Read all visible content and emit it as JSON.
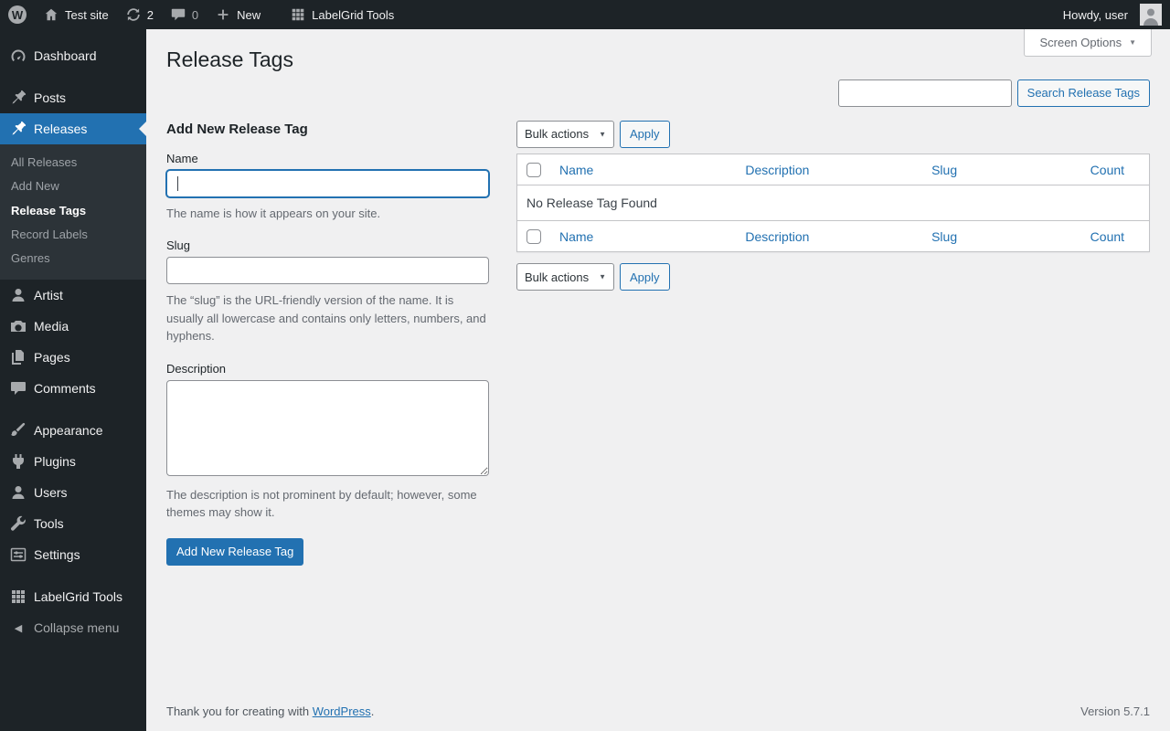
{
  "colors": {
    "accent": "#2271b1",
    "bar_bg": "#1d2327",
    "submenu_bg": "#2c3338",
    "content_bg": "#f0f0f1"
  },
  "icons": {
    "wp_logo": "W",
    "chevron_down": "▼",
    "collapse_arrow": "◀"
  },
  "admin_bar": {
    "site_name": "Test site",
    "updates_count": "2",
    "comments_count": "0",
    "new_label": "New",
    "labelgrid_label": "LabelGrid Tools",
    "howdy_label": "Howdy, user"
  },
  "sidebar": {
    "dashboard": "Dashboard",
    "posts": "Posts",
    "releases": "Releases",
    "submenu": {
      "all_releases": "All Releases",
      "add_new": "Add New",
      "release_tags": "Release Tags",
      "record_labels": "Record Labels",
      "genres": "Genres"
    },
    "artist": "Artist",
    "media": "Media",
    "pages": "Pages",
    "comments": "Comments",
    "appearance": "Appearance",
    "plugins": "Plugins",
    "users": "Users",
    "tools": "Tools",
    "settings": "Settings",
    "labelgrid": "LabelGrid Tools",
    "collapse": "Collapse menu"
  },
  "page": {
    "title": "Release Tags",
    "screen_options_label": "Screen Options",
    "search_value": "",
    "search_button_label": "Search Release Tags"
  },
  "form": {
    "heading": "Add New Release Tag",
    "name_label": "Name",
    "name_value": "",
    "name_help": "The name is how it appears on your site.",
    "slug_label": "Slug",
    "slug_value": "",
    "slug_help": "The “slug” is the URL-friendly version of the name. It is usually all lowercase and contains only letters, numbers, and hyphens.",
    "description_label": "Description",
    "description_value": "",
    "description_help": "The description is not prominent by default; however, some themes may show it.",
    "submit_label": "Add New Release Tag"
  },
  "list": {
    "bulk_actions_label": "Bulk actions",
    "apply_label": "Apply",
    "columns": {
      "name": "Name",
      "description": "Description",
      "slug": "Slug",
      "count": "Count"
    },
    "empty_message": "No Release Tag Found"
  },
  "footer": {
    "thanks_text": "Thank you for creating with",
    "wordpress_link": "WordPress",
    "period": ".",
    "version": "Version 5.7.1"
  }
}
